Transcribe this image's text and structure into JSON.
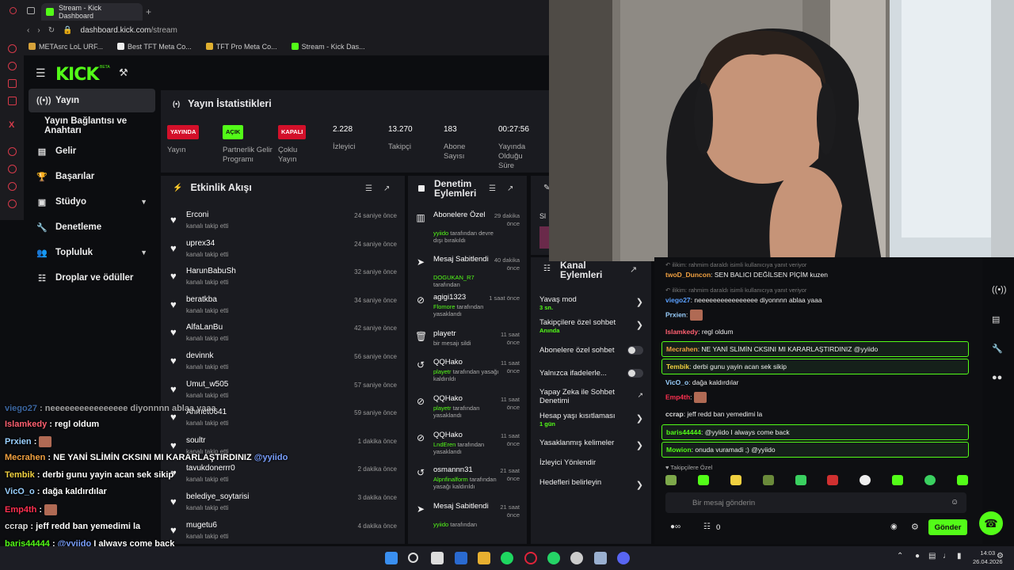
{
  "browser": {
    "tab_title": "Stream - Kick Dashboard",
    "new_tab": "+",
    "url_host": "dashboard.kick.com",
    "url_path": "/stream",
    "bookmarks": [
      {
        "label": "METAsrc LoL URF...",
        "color": "#d6a23a"
      },
      {
        "label": "Best TFT Meta Co...",
        "color": "#eeeeee"
      },
      {
        "label": "TFT Pro Meta Co...",
        "color": "#e0b030"
      },
      {
        "label": "Stream - Kick Das...",
        "color": "#53fc18"
      }
    ]
  },
  "sidebar": {
    "logo": "KICK",
    "beta": "BETA",
    "items": [
      {
        "label": "Yayın",
        "icon": "broadcast-icon"
      },
      {
        "label": "Yayın Bağlantısı ve Anahtarı"
      },
      {
        "label": "Gelir",
        "icon": "bank-icon"
      },
      {
        "label": "Başarılar",
        "icon": "trophy-icon"
      },
      {
        "label": "Stüdyo",
        "icon": "studio-icon",
        "chevron": "⌄"
      },
      {
        "label": "Denetleme",
        "icon": "wrench-icon"
      },
      {
        "label": "Topluluk",
        "icon": "people-icon",
        "chevron": "⌄"
      },
      {
        "label": "Droplar ve ödüller",
        "icon": "gift-icon"
      }
    ]
  },
  "stats": {
    "title": "Yayın İstatistikleri",
    "items": [
      {
        "badge": "YAYINDA",
        "label": "Yayın"
      },
      {
        "badge": "AÇIK",
        "label": "Partnerlik Gelir Programı"
      },
      {
        "badge": "KAPALI",
        "label": "Çoklu Yayın"
      },
      {
        "value": "2.228",
        "label": "İzleyici"
      },
      {
        "value": "13.270",
        "label": "Takipçi"
      },
      {
        "value": "183",
        "label": "Abone Sayısı"
      },
      {
        "value": "00:27:56",
        "label": "Yayında Olduğu Süre"
      }
    ]
  },
  "activity": {
    "title": "Etkinlik Akışı",
    "items": [
      {
        "name": "Erconi",
        "sub": "kanalı takip etti",
        "time": "24 saniye önce"
      },
      {
        "name": "uprex34",
        "sub": "kanalı takip etti",
        "time": "24 saniye önce"
      },
      {
        "name": "HarunBabuSh",
        "sub": "kanalı takip etti",
        "time": "32 saniye önce"
      },
      {
        "name": "beratkba",
        "sub": "kanalı takip etti",
        "time": "34 saniye önce"
      },
      {
        "name": "AlfaLanBu",
        "sub": "kanalı takip etti",
        "time": "42 saniye önce"
      },
      {
        "name": "devinnk",
        "sub": "kanalı takip etti",
        "time": "56 saniye önce"
      },
      {
        "name": "Umut_w505",
        "sub": "kanalı takip etti",
        "time": "57 saniye önce"
      },
      {
        "name": "Ahmet0641",
        "sub": "kanalı takip etti",
        "time": "59 saniye önce"
      },
      {
        "name": "soultr",
        "sub": "kanalı takip etti",
        "time": "1 dakika önce"
      },
      {
        "name": "tavukdonerrr0",
        "sub": "kanalı takip etti",
        "time": "2 dakika önce"
      },
      {
        "name": "belediye_soytarisi",
        "sub": "kanalı takip etti",
        "time": "3 dakika önce"
      },
      {
        "name": "mugetu6",
        "sub": "kanalı takip etti",
        "time": "4 dakika önce"
      }
    ]
  },
  "moderation": {
    "title": "Denetim Eylemleri",
    "items": [
      {
        "icon": "subscriber-icon",
        "title": "Abonelere Özel",
        "user": "yyiido",
        "desc": "tarafından devre dışı bırakıldı",
        "time": "29 dakika önce"
      },
      {
        "icon": "pin-icon",
        "title": "Mesaj Sabitlendi",
        "user": "DOGUKAN_R7",
        "desc": "tarafından",
        "time": "40 dakika önce"
      },
      {
        "icon": "ban-icon",
        "title": "agigi1323",
        "user": "Flomore",
        "desc": "tarafından yasaklandı",
        "time": "1 saat önce"
      },
      {
        "icon": "trash-icon",
        "title": "playetr",
        "user": "",
        "desc": "bir mesajı sildi",
        "time": "11 saat önce"
      },
      {
        "icon": "undo-icon",
        "title": "QQHako",
        "user": "playetr",
        "desc": "tarafından yasağı kaldırıldı",
        "time": "11 saat önce"
      },
      {
        "icon": "ban-icon",
        "title": "QQHako",
        "user": "playetr",
        "desc": "tarafından yasaklandı",
        "time": "11 saat önce"
      },
      {
        "icon": "ban-icon",
        "title": "QQHako",
        "user": "LndEren",
        "desc": "tarafından yasaklandı",
        "time": "11 saat önce"
      },
      {
        "icon": "undo-icon",
        "title": "osmannn31",
        "user": "Alpnfinalform",
        "desc": "tarafından yasağı kaldırıldı",
        "time": "21 saat önce"
      },
      {
        "icon": "pin-icon",
        "title": "Mesaj Sabitlendi",
        "user": "yyiido",
        "desc": "tarafından",
        "time": "21 saat önce"
      }
    ]
  },
  "channel_actions": {
    "title": "Kanal Eylemleri",
    "items": [
      {
        "label": "Yavaş mod",
        "sub": "3 sn.",
        "control": "arrow"
      },
      {
        "label": "Takipçilere özel sohbet",
        "sub": "Anında",
        "control": "arrow"
      },
      {
        "label": "Abonelere özel sohbet",
        "sub": "",
        "control": "toggle"
      },
      {
        "label": "Yalnızca ifadelerle...",
        "sub": "",
        "control": "toggle"
      },
      {
        "label": "Yapay Zeka ile Sohbet Denetimi",
        "sub": "",
        "control": "external"
      },
      {
        "label": "Hesap yaşı kısıtlaması",
        "sub": "1 gün",
        "control": "arrow"
      },
      {
        "label": "Yasaklanmış kelimeler",
        "sub": "",
        "control": "arrow"
      },
      {
        "label": "İzleyici Yönlendir",
        "sub": "",
        "control": ""
      },
      {
        "label": "Hedefleri belirleyin",
        "sub": "",
        "control": "arrow"
      }
    ]
  },
  "chat": {
    "messages": [
      {
        "reply": "ilikim: rahmim daraldı isimli kullanıcıya yanıt veriyor",
        "user": "twoD_Duncon",
        "color": "#f0a040",
        "text": "SEN BALICI DEĞİLSEN PİÇİM kuzen"
      },
      {
        "reply": "ilikim: rahmim daraldı isimli kullanıcıya yanıt veriyor",
        "user": "viego27",
        "color": "#5aa0ff",
        "text": "neeeeeeeeeeeeeeee diyonnnn ablaa yaaa"
      },
      {
        "user": "Prxien",
        "color": "#9ad0ff",
        "text": "",
        "emote": true
      },
      {
        "user": "Islamkedy",
        "color": "#ff6070",
        "text": "regl oldum"
      },
      {
        "user": "Mecrahen",
        "color": "#f0a040",
        "text": "NE YANİ SLİMİN CKSINI MI KARARLAŞTIRDINIZ @yyiido",
        "highlight": true
      },
      {
        "user": "Tembik",
        "color": "#f0d040",
        "text": "derbi gunu yayin acan sek sikip",
        "highlight": true
      },
      {
        "user": "VicO_o",
        "color": "#9ad0ff",
        "text": "dağa kaldırdılar"
      },
      {
        "user": "Emp4th",
        "color": "#ff3050",
        "text": "",
        "emote": true
      },
      {
        "user": "ccrap",
        "color": "#dddddd",
        "text": "jeff redd ban yemedimi la"
      },
      {
        "user": "baris44444",
        "color": "#53fc18",
        "text": "@yyiido I always come back",
        "highlight": true
      },
      {
        "user": "Mowion",
        "color": "#53fc18",
        "text": "onuda vuramadi ;) @yyiido",
        "highlight": true
      }
    ],
    "mode_label": "Takipçilere Özel",
    "placeholder": "Bir mesaj gönderin",
    "viewer_count": "0",
    "send_label": "Gönder"
  },
  "overlay_chat": [
    {
      "user": "viego27",
      "color": "#5aa0ff",
      "text": "neeeeeeeeeeeeeeee diyonnnn ablaa yaaa"
    },
    {
      "user": "Islamkedy",
      "color": "#ff6070",
      "text": "regl oldum"
    },
    {
      "user": "Prxien",
      "color": "#9ad0ff",
      "text": "",
      "emote": true
    },
    {
      "user": "Mecrahen",
      "color": "#f0a040",
      "text": "NE YANİ SLİMİN CKSINI MI KARARLAŞTIRDINIZ",
      "mention": "@yyiido"
    },
    {
      "user": "Tembik",
      "color": "#f0d040",
      "text": "derbi gunu yayin acan sek sikip"
    },
    {
      "user": "VicO_o",
      "color": "#9ad0ff",
      "text": "dağa kaldırdılar"
    },
    {
      "user": "Emp4th",
      "color": "#ff3050",
      "text": "",
      "emote": true
    },
    {
      "user": "ccrap",
      "color": "#dddddd",
      "text": "jeff redd ban yemedimi la"
    },
    {
      "user": "baris44444",
      "color": "#53fc18",
      "text": "",
      "mention": "@yyiido",
      "after": "I always come back"
    },
    {
      "user": "Mowion",
      "color": "#53fc18",
      "text": "onuda vuramadi ;)",
      "mention": "@yyiido"
    }
  ],
  "taskbar": {
    "time": "14:03",
    "date": "26.04.2026"
  }
}
